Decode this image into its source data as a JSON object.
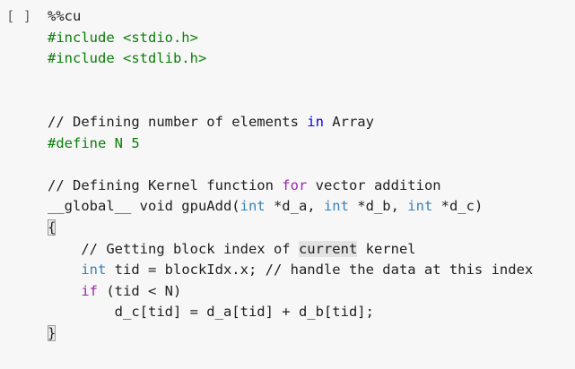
{
  "cell": {
    "run_button_label": "[ ]",
    "magic": "%%cu"
  },
  "code_lines": [
    {
      "tokens": [
        {
          "t": "%%cu",
          "c": "plain"
        }
      ]
    },
    {
      "tokens": [
        {
          "t": "#include <stdio.h>",
          "c": "pre"
        }
      ]
    },
    {
      "tokens": [
        {
          "t": "#include <stdlib.h>",
          "c": "pre"
        }
      ]
    },
    {
      "tokens": []
    },
    {
      "tokens": []
    },
    {
      "tokens": [
        {
          "t": "// Defining number of elements ",
          "c": "comment"
        },
        {
          "t": "in",
          "c": "kw"
        },
        {
          "t": " Array",
          "c": "comment"
        }
      ]
    },
    {
      "tokens": [
        {
          "t": "#define N 5",
          "c": "pre"
        }
      ]
    },
    {
      "tokens": []
    },
    {
      "tokens": [
        {
          "t": "// Defining Kernel function ",
          "c": "comment"
        },
        {
          "t": "for",
          "c": "ctrl"
        },
        {
          "t": " vector addition",
          "c": "comment"
        }
      ]
    },
    {
      "tokens": [
        {
          "t": "__global__ void gpuAdd(",
          "c": "plain"
        },
        {
          "t": "int",
          "c": "type"
        },
        {
          "t": " *d_a, ",
          "c": "plain"
        },
        {
          "t": "int",
          "c": "type"
        },
        {
          "t": " *d_b, ",
          "c": "plain"
        },
        {
          "t": "int",
          "c": "type"
        },
        {
          "t": " *d_c)",
          "c": "plain"
        }
      ]
    },
    {
      "tokens": [
        {
          "t": "{",
          "c": "plain",
          "hl": "bracket"
        }
      ]
    },
    {
      "tokens": [
        {
          "t": "    // Getting block index of ",
          "c": "comment"
        },
        {
          "t": "current",
          "c": "comment",
          "hl": "word"
        },
        {
          "t": " kernel",
          "c": "comment"
        }
      ]
    },
    {
      "tokens": [
        {
          "t": "    ",
          "c": "plain"
        },
        {
          "t": "int",
          "c": "type"
        },
        {
          "t": " tid = blockIdx.x; // handle the data at this index",
          "c": "plain"
        }
      ]
    },
    {
      "tokens": [
        {
          "t": "    ",
          "c": "plain"
        },
        {
          "t": "if",
          "c": "ctrl"
        },
        {
          "t": " (tid < N)",
          "c": "plain"
        }
      ]
    },
    {
      "tokens": [
        {
          "t": "        d_c[tid] = d_a[tid] + d_b[tid];",
          "c": "plain"
        }
      ]
    },
    {
      "tokens": [
        {
          "t": "}",
          "c": "plain",
          "hl": "bracket"
        }
      ]
    }
  ]
}
